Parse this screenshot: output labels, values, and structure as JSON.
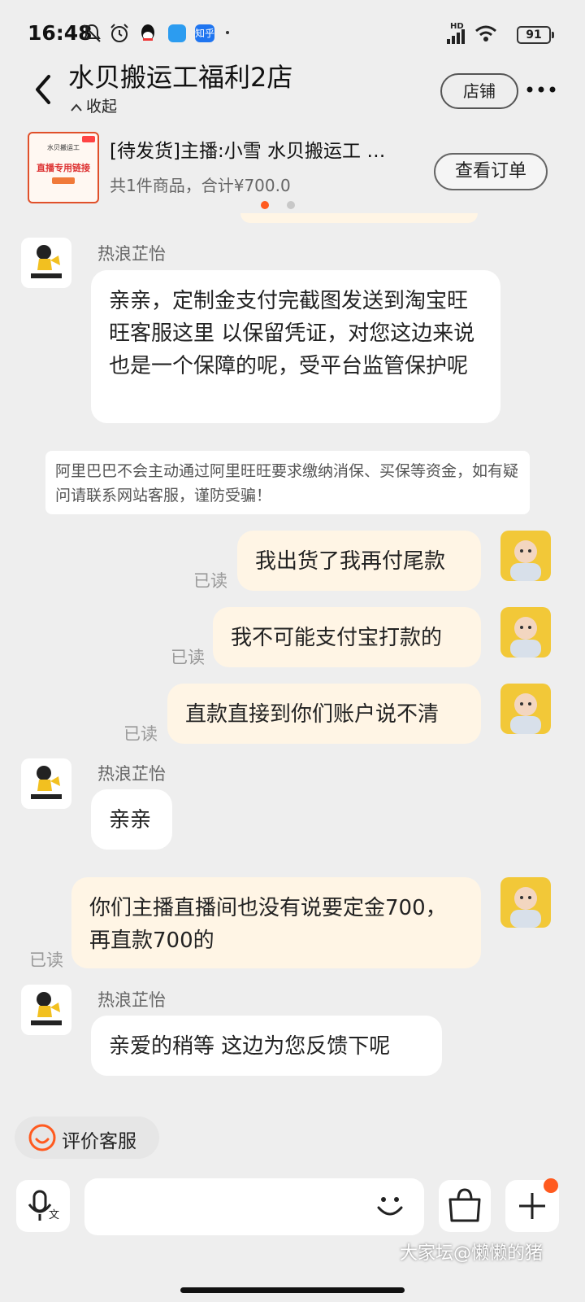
{
  "status_bar": {
    "time": "16:48",
    "network_label": "HD",
    "battery": "91",
    "zhihu_label": "知乎"
  },
  "header": {
    "title": "水贝搬运工福利2店",
    "collapse_label": "收起",
    "store_button": "店铺"
  },
  "order": {
    "title": "[待发货]主播:小雪 水贝搬运工 …",
    "summary": "共1件商品，合计¥700.0",
    "view_button": "查看订单",
    "thumb_brand": "水贝搬运工",
    "thumb_caption": "直播专用链接",
    "page_count": 2,
    "active_page": 1
  },
  "messages": {
    "sender_1": "热浪芷怡",
    "msg_1": "亲亲，定制金支付完截图发送到淘宝旺旺客服这里 以保留凭证，对您这边来说也是一个保障的呢，受平台监管保护呢",
    "notice": "阿里巴巴不会主动通过阿里旺旺要求缴纳消保、买保等资金，如有疑问请联系网站客服，谨防受骗！",
    "out_1": "我出货了我再付尾款",
    "out_2": "我不可能支付宝打款的",
    "out_3": "直款直接到你们账户说不清",
    "sender_2": "热浪芷怡",
    "msg_2": "亲亲",
    "out_4": "你们主播直播间也没有说要定金700，再直款700的",
    "sender_3": "热浪芷怡",
    "msg_3": "亲爱的稍等  这边为您反馈下呢",
    "read_label": "已读"
  },
  "bottom": {
    "rate_label": "评价客服",
    "mic_sub": "文",
    "input_placeholder": ""
  },
  "watermark": "大家坛@懒懒的猪",
  "colors": {
    "accent": "#ff5a1f",
    "bubble_out": "#fff5e5",
    "background": "#eeeeee"
  }
}
